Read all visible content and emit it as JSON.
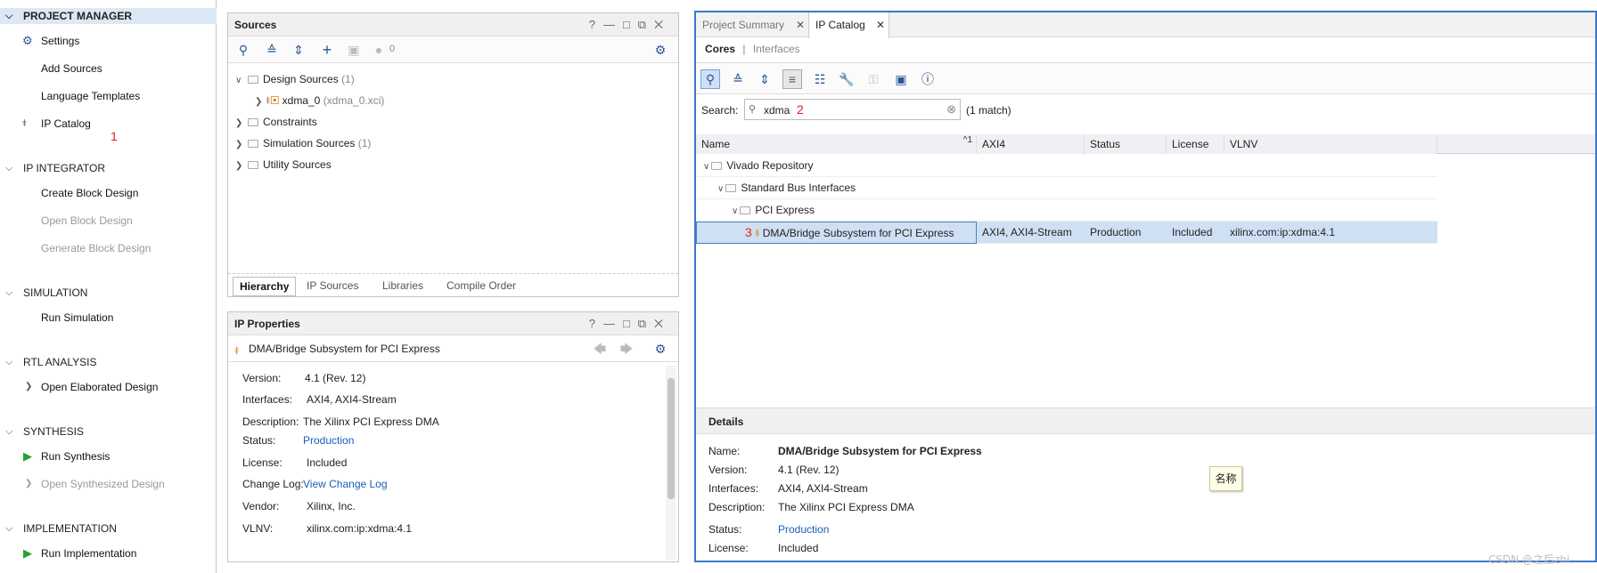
{
  "nav": {
    "project_manager": {
      "title": "PROJECT MANAGER",
      "settings": "Settings",
      "add_sources": "Add Sources",
      "language_templates": "Language Templates",
      "ip_catalog": "IP Catalog",
      "marker": "1"
    },
    "ip_integrator": {
      "title": "IP INTEGRATOR",
      "create_block": "Create Block Design",
      "open_block": "Open Block Design",
      "generate_block": "Generate Block Design"
    },
    "simulation": {
      "title": "SIMULATION",
      "run": "Run Simulation"
    },
    "rtl": {
      "title": "RTL ANALYSIS",
      "open": "Open Elaborated Design"
    },
    "synthesis": {
      "title": "SYNTHESIS",
      "run": "Run Synthesis",
      "open": "Open Synthesized Design"
    },
    "implementation": {
      "title": "IMPLEMENTATION",
      "run": "Run Implementation"
    }
  },
  "sources": {
    "title": "Sources",
    "badge": "0",
    "tree": {
      "design": {
        "label": "Design Sources",
        "count": "(1)"
      },
      "xdma": {
        "label": "xdma_0",
        "file": "(xdma_0.xci)"
      },
      "constraints": {
        "label": "Constraints"
      },
      "sim": {
        "label": "Simulation Sources",
        "count": "(1)"
      },
      "utility": {
        "label": "Utility Sources"
      }
    },
    "tabs": [
      "Hierarchy",
      "IP Sources",
      "Libraries",
      "Compile Order"
    ]
  },
  "ip_props": {
    "title": "IP Properties",
    "name": "DMA/Bridge Subsystem for PCI Express",
    "rows": [
      {
        "k": "Version:",
        "v": "4.1 (Rev. 12)"
      },
      {
        "k": "Interfaces:",
        "v": "AXI4, AXI4-Stream"
      },
      {
        "k": "Description:",
        "v": "The Xilinx PCI Express DMA"
      },
      {
        "k": "Status:",
        "v": "Production"
      },
      {
        "k": "License:",
        "v": "Included"
      },
      {
        "k": "Change Log:",
        "v": "View Change Log"
      },
      {
        "k": "Vendor:",
        "v": "Xilinx, Inc."
      },
      {
        "k": "VLNV:",
        "v": "xilinx.com:ip:xdma:4.1"
      }
    ]
  },
  "catalog": {
    "tabs": [
      "Project Summary",
      "IP Catalog"
    ],
    "subtabs": {
      "cores": "Cores",
      "sep": "|",
      "interfaces": "Interfaces"
    },
    "search": {
      "label": "Search:",
      "value": "xdma",
      "marker": "2",
      "match": "(1 match)"
    },
    "columns": {
      "name": "Name",
      "sort": "1",
      "axi4": "AXI4",
      "status": "Status",
      "license": "License",
      "vlnv": "VLNV"
    },
    "tree": {
      "repo": "Vivado Repository",
      "std": "Standard Bus Interfaces",
      "pci": "PCI Express",
      "marker": "3",
      "ip": {
        "name": "DMA/Bridge Subsystem for PCI Express",
        "axi4": "AXI4, AXI4-Stream",
        "status": "Production",
        "license": "Included",
        "vlnv": "xilinx.com:ip:xdma:4.1"
      }
    },
    "details": {
      "title": "Details",
      "rows": [
        {
          "k": "Name:",
          "v": "DMA/Bridge Subsystem for PCI Express"
        },
        {
          "k": "Version:",
          "v": "4.1 (Rev. 12)"
        },
        {
          "k": "Interfaces:",
          "v": "AXI4, AXI4-Stream"
        },
        {
          "k": "Description:",
          "v": "The Xilinx PCI Express DMA"
        },
        {
          "k": "Status:",
          "v": "Production"
        },
        {
          "k": "License:",
          "v": "Included"
        }
      ]
    },
    "tooltip": "名称"
  },
  "watermark": "CSDN @之后zhi",
  "colors": {
    "accent": "#3c78c8",
    "selected": "#cfe0f5",
    "link": "#1a5fb4",
    "marker": "#e02020",
    "run_icon": "#2aa02a"
  }
}
